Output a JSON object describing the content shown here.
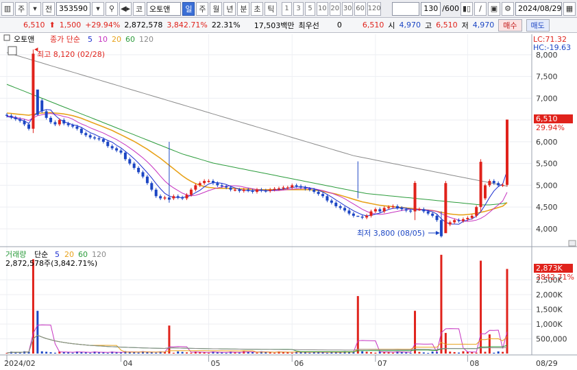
{
  "toolbar": {
    "period_label": "주",
    "prev_label": "전",
    "stock_code": "353590",
    "market_label": "코",
    "stock_name": "오토앤",
    "period_tabs": [
      "일",
      "주",
      "월",
      "년",
      "분",
      "초",
      "틱"
    ],
    "active_tab": "일",
    "interval_buttons": [
      "1",
      "3",
      "5",
      "10",
      "20",
      "30",
      "60",
      "120"
    ],
    "bar_count": "130",
    "bar_max": "/600",
    "date": "2024/08/29"
  },
  "infobar": {
    "price": "6,510",
    "change": "1,500",
    "change_pct": "+29.94%",
    "volume": "2,872,578",
    "volume_pct": "3,842.71%",
    "turnover": "22.31%",
    "amount": "17,503백만",
    "pref_label": "최우선",
    "pref_value": "0",
    "best_price": "6,510",
    "open_label": "시",
    "open": "4,970",
    "high_label": "고",
    "high": "6,510",
    "low_label": "저",
    "low": "4,970",
    "buy_label": "매수",
    "sell_label": "매도"
  },
  "colors": {
    "up": "#e0221b",
    "down": "#1c46c4",
    "ma5": "#1c2fd0",
    "ma10": "#c531c0",
    "ma20": "#e8a21a",
    "ma60": "#2a9b3a",
    "ma120": "#8a8a8a"
  },
  "chart_data": {
    "type": "line",
    "price_panel": {
      "stock_name": "오토앤",
      "legend_prefix": "종가 단순",
      "ma_periods": [
        "5",
        "10",
        "20",
        "60",
        "120"
      ],
      "y_ticks": [
        "8,000",
        "7,500",
        "7,000",
        "6,500",
        "6,000",
        "5,500",
        "5,000",
        "4,500",
        "4,000"
      ],
      "ylim": [
        3700,
        8250
      ],
      "lc_label": "LC:71.32",
      "hc_label": "HC:-19.63",
      "max_annotation": "최고 8,120 (02/28)",
      "min_annotation": "최저 3,800 (08/05)",
      "last_price_tag": "6,510",
      "last_pct_tag": "29.94%",
      "close": [
        6600,
        6560,
        6520,
        6480,
        6400,
        6300,
        7200,
        6950,
        6700,
        6550,
        6450,
        6400,
        6500,
        6420,
        6380,
        6350,
        6300,
        6200,
        6150,
        6100,
        6080,
        6060,
        6000,
        5900,
        5850,
        5800,
        5750,
        5600,
        5500,
        5400,
        5300,
        5200,
        5050,
        4900,
        4750,
        4700,
        4720,
        4700,
        4750,
        4720,
        4700,
        4780,
        4900,
        5000,
        5050,
        5100,
        5100,
        5050,
        5000,
        4980,
        4950,
        4900,
        4900,
        4870,
        4900,
        4880,
        4850,
        4900,
        4880,
        4870,
        4900,
        4920,
        4930,
        4950,
        4950,
        5000,
        4980,
        4950,
        4920,
        4900,
        4850,
        4800,
        4750,
        4650,
        4600,
        4520,
        4480,
        4420,
        4350,
        4300,
        4280,
        4260,
        4300,
        4400,
        4450,
        4400,
        4480,
        4500,
        4520,
        4480,
        4450,
        4420,
        4400,
        4450,
        4450,
        4400,
        4350,
        4300,
        4200,
        3900,
        4100,
        4150,
        4200,
        4180,
        4220,
        4250,
        4300,
        4500,
        4700,
        5000,
        5100,
        5050,
        5000,
        5010,
        6510
      ],
      "ma5": [
        6580,
        6560,
        6540,
        6510,
        6480,
        6420,
        6580,
        6670,
        6710,
        6740,
        6730,
        6610,
        6520,
        6460,
        6430,
        6390,
        6370,
        6330,
        6270,
        6210,
        6170,
        6120,
        6080,
        6030,
        5990,
        5920,
        5860,
        5780,
        5700,
        5610,
        5510,
        5400,
        5290,
        5170,
        5040,
        4920,
        4814,
        4754,
        4724,
        4718,
        4718,
        4734,
        4770,
        4830,
        4886,
        4966,
        5030,
        5060,
        5060,
        5046,
        5020,
        4976,
        4940,
        4906,
        4884,
        4876,
        4880,
        4880,
        4882,
        4876,
        4880,
        4894,
        4900,
        4914,
        4930,
        4950,
        4962,
        4966,
        4960,
        4940,
        4920,
        4884,
        4844,
        4790,
        4730,
        4664,
        4600,
        4534,
        4474,
        4414,
        4366,
        4322,
        4298,
        4308,
        4338,
        4362,
        4406,
        4446,
        4470,
        4476,
        4486,
        4470,
        4454,
        4440,
        4434,
        4434,
        4414,
        4390,
        4340,
        4230,
        4150,
        4110,
        4110,
        4106,
        4170,
        4200,
        4230,
        4290,
        4394,
        4550,
        4720,
        4870,
        4970,
        5030,
        5334
      ],
      "ma10": [
        6590,
        6580,
        6560,
        6540,
        6520,
        6490,
        6550,
        6600,
        6620,
        6640,
        6650,
        6630,
        6610,
        6580,
        6560,
        6520,
        6460,
        6410,
        6370,
        6320,
        6280,
        6240,
        6200,
        6150,
        6100,
        6050,
        5990,
        5930,
        5860,
        5790,
        5710,
        5630,
        5540,
        5440,
        5330,
        5210,
        5100,
        5010,
        4940,
        4880,
        4820,
        4780,
        4760,
        4770,
        4800,
        4840,
        4880,
        4910,
        4940,
        4960,
        4980,
        4990,
        4990,
        4980,
        4960,
        4940,
        4920,
        4900,
        4890,
        4880,
        4880,
        4880,
        4880,
        4890,
        4900,
        4910,
        4920,
        4930,
        4930,
        4930,
        4920,
        4900,
        4880,
        4850,
        4820,
        4780,
        4740,
        4690,
        4630,
        4570,
        4510,
        4450,
        4400,
        4360,
        4340,
        4330,
        4340,
        4360,
        4380,
        4400,
        4420,
        4440,
        4450,
        4450,
        4450,
        4440,
        4430,
        4420,
        4400,
        4350,
        4300,
        4260,
        4230,
        4200,
        4180,
        4170,
        4180,
        4200,
        4240,
        4300,
        4380,
        4470,
        4550,
        4640,
        4840
      ],
      "ma20": [
        6660,
        6650,
        6640,
        6630,
        6620,
        6610,
        6630,
        6650,
        6660,
        6670,
        6670,
        6660,
        6650,
        6640,
        6620,
        6600,
        6570,
        6540,
        6500,
        6460,
        6420,
        6380,
        6340,
        6300,
        6260,
        6210,
        6160,
        6110,
        6060,
        6010,
        5950,
        5890,
        5830,
        5760,
        5690,
        5620,
        5540,
        5460,
        5380,
        5300,
        5220,
        5150,
        5090,
        5040,
        5000,
        4970,
        4950,
        4940,
        4930,
        4930,
        4930,
        4930,
        4930,
        4920,
        4920,
        4910,
        4910,
        4900,
        4900,
        4900,
        4900,
        4900,
        4900,
        4900,
        4900,
        4900,
        4900,
        4900,
        4900,
        4900,
        4890,
        4880,
        4860,
        4840,
        4820,
        4800,
        4770,
        4740,
        4710,
        4680,
        4650,
        4620,
        4600,
        4580,
        4560,
        4540,
        4530,
        4520,
        4510,
        4500,
        4490,
        4480,
        4470,
        4460,
        4450,
        4440,
        4430,
        4420,
        4400,
        4380,
        4360,
        4340,
        4330,
        4320,
        4320,
        4330,
        4340,
        4360,
        4380,
        4400,
        4430,
        4460,
        4490,
        4520,
        4600
      ],
      "ma60": [
        7320,
        7280,
        7240,
        7200,
        7160,
        7120,
        7080,
        7040,
        7000,
        6960,
        6920,
        6880,
        6840,
        6800,
        6760,
        6720,
        6680,
        6640,
        6600,
        6560,
        6520,
        6480,
        6440,
        6400,
        6360,
        6320,
        6280,
        6240,
        6200,
        6160,
        6120,
        6080,
        6040,
        6000,
        5960,
        5920,
        5880,
        5840,
        5800,
        5760,
        5720,
        5690,
        5660,
        5630,
        5600,
        5570,
        5540,
        5510,
        5490,
        5470,
        5450,
        5430,
        5410,
        5390,
        5370,
        5350,
        5330,
        5310,
        5290,
        5270,
        5250,
        5230,
        5210,
        5190,
        5170,
        5150,
        5130,
        5110,
        5090,
        5070,
        5050,
        5030,
        5010,
        4990,
        4970,
        4950,
        4930,
        4910,
        4890,
        4870,
        4850,
        4830,
        4810,
        4800,
        4790,
        4780,
        4770,
        4760,
        4750,
        4740,
        4730,
        4720,
        4710,
        4700,
        4690,
        4680,
        4670,
        4660,
        4650,
        4640,
        4630,
        4620,
        4610,
        4600,
        4590,
        4580,
        4570,
        4560,
        4550,
        4550,
        4550,
        4560,
        4570,
        4580,
        4600
      ],
      "ma120": [
        8050,
        8020,
        7990,
        7960,
        7930,
        7900,
        7870,
        7840,
        7810,
        7780,
        7750,
        7720,
        7690,
        7660,
        7630,
        7600,
        7570,
        7540,
        7510,
        7480,
        7450,
        7420,
        7390,
        7360,
        7330,
        7300,
        7270,
        7240,
        7210,
        7180,
        7150,
        7120,
        7090,
        7060,
        7030,
        7000,
        6970,
        6940,
        6910,
        6880,
        6850,
        6820,
        6790,
        6760,
        6730,
        6700,
        6670,
        6640,
        6610,
        6580,
        6550,
        6520,
        6490,
        6460,
        6430,
        6400,
        6370,
        6340,
        6310,
        6280,
        6250,
        6220,
        6190,
        6160,
        6130,
        6100,
        6070,
        6040,
        6010,
        5980,
        5950,
        5920,
        5890,
        5860,
        5830,
        5800,
        5770,
        5740,
        5710,
        5680,
        5660,
        5640,
        5620,
        5600,
        5580,
        5560,
        5540,
        5520,
        5500,
        5480,
        5460,
        5440,
        5420,
        5400,
        5380,
        5360,
        5340,
        5320,
        5300,
        5280,
        5260,
        5240,
        5220,
        5200,
        5180,
        5160,
        5140,
        5120,
        5100,
        5080,
        5060,
        5040,
        5020,
        5000,
        4980
      ],
      "spikes": [
        {
          "i": 6,
          "high": 8120,
          "low": 6200,
          "up": true
        },
        {
          "i": 7,
          "high": 7000,
          "low": 6600,
          "up": false
        },
        {
          "i": 37,
          "high": 6000,
          "low": 4600,
          "up": false
        },
        {
          "i": 80,
          "high": 5550,
          "low": 4700,
          "up": false
        },
        {
          "i": 93,
          "high": 5100,
          "low": 4200,
          "up": true
        },
        {
          "i": 99,
          "high": 4400,
          "low": 3800,
          "up": false
        },
        {
          "i": 100,
          "high": 5100,
          "low": 4100,
          "up": true
        },
        {
          "i": 108,
          "high": 5600,
          "low": 4400,
          "up": true
        },
        {
          "i": 114,
          "high": 6510,
          "low": 4970,
          "up": true
        }
      ]
    },
    "volume_panel": {
      "legend_name": "거래량",
      "legend_prefix": "단순",
      "ma_periods": [
        "5",
        "20",
        "60",
        "120"
      ],
      "value_label": "2,872,578주(3,842.71%)",
      "y_ticks": [
        "2,500K",
        "2,000K",
        "1,500K",
        "1,000K",
        "500,000"
      ],
      "ylim": [
        0,
        3300000
      ],
      "last_tag": "2,873K",
      "last_pct_tag": "3842.71%",
      "big_bars": [
        {
          "i": 6,
          "v": 3200000,
          "up": true
        },
        {
          "i": 7,
          "v": 1450000,
          "up": false
        },
        {
          "i": 37,
          "v": 950000,
          "up": true
        },
        {
          "i": 80,
          "v": 1950000,
          "up": true
        },
        {
          "i": 93,
          "v": 1450000,
          "up": true
        },
        {
          "i": 99,
          "v": 3350000,
          "up": true
        },
        {
          "i": 100,
          "v": 700000,
          "up": true
        },
        {
          "i": 108,
          "v": 3150000,
          "up": true
        },
        {
          "i": 110,
          "v": 650000,
          "up": true
        },
        {
          "i": 114,
          "v": 2870000,
          "up": true
        }
      ]
    },
    "x_labels": [
      {
        "label": "2024/02",
        "i": 0
      },
      {
        "label": "04",
        "i": 26
      },
      {
        "label": "05",
        "i": 46
      },
      {
        "label": "06",
        "i": 65
      },
      {
        "label": "07",
        "i": 84
      },
      {
        "label": "08",
        "i": 105
      }
    ],
    "x_last_label": "08/29"
  }
}
